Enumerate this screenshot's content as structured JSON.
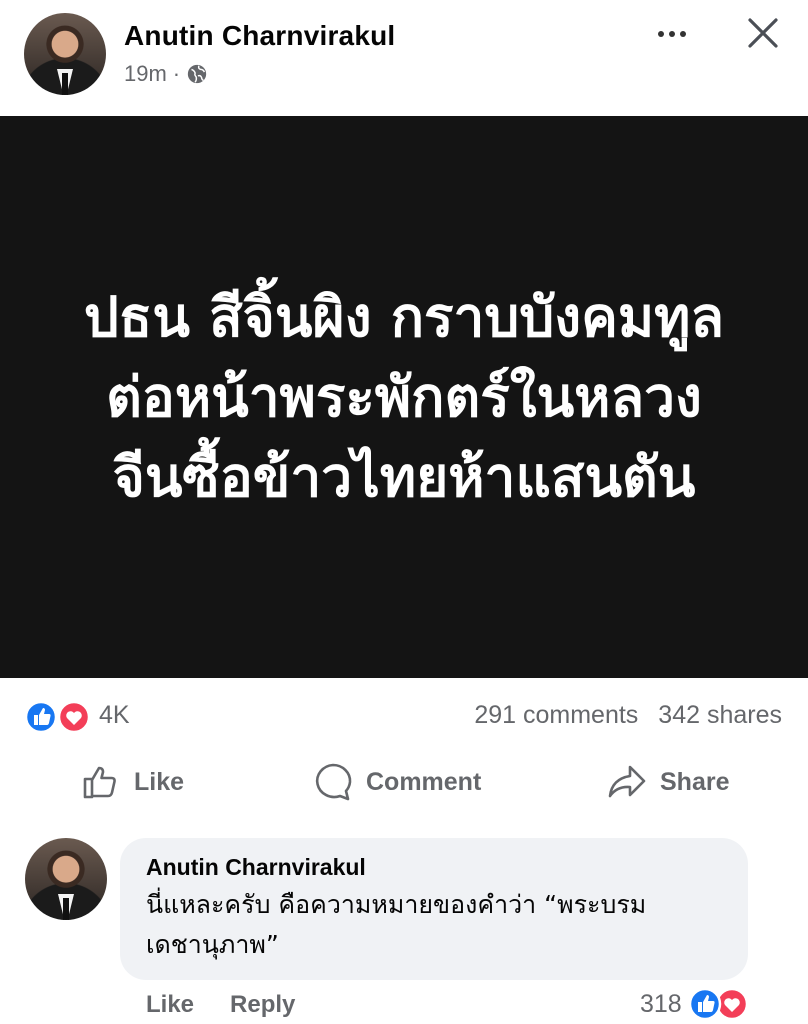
{
  "post": {
    "author": "Anutin Charnvirakul",
    "time": "19m",
    "separator": "·",
    "audience_icon": "globe-icon",
    "image_text": [
      "ปธน สีจิ้นผิง กราบบังคมทูล",
      "ต่อหน้าพระพักตร์ในหลวง",
      "จีนซื้อข้าวไทยห้าแสนตัน"
    ],
    "image_background": "#141414"
  },
  "stats": {
    "reactions": "4K",
    "comments": "291 comments",
    "shares": "342 shares",
    "like_color": "#1877f2",
    "love_color": "#f33e58"
  },
  "actions": {
    "like": "Like",
    "comment": "Comment",
    "share": "Share"
  },
  "comment": {
    "author": "Anutin Charnvirakul",
    "text_line1": "นี่แหละครับ คือความหมายของคำว่า “พระบรม",
    "text_line2": "เดชานุภาพ”",
    "like_label": "Like",
    "reply_label": "Reply",
    "reaction_count": "318"
  }
}
